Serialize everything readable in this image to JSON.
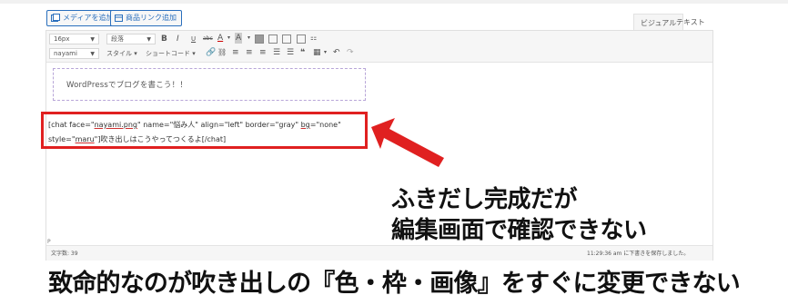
{
  "media_buttons": {
    "add_media": "メディアを追加",
    "product_link": "商品リンク追加"
  },
  "mode_tabs": {
    "visual": "ビジュアル",
    "text": "テキスト"
  },
  "toolbar": {
    "font_size": "16px",
    "paragraph": "段落",
    "font_family": "nayami",
    "styles": "スタイル",
    "shortcode": "ショートコード",
    "bold": "B",
    "italic": "I",
    "underline": "U",
    "strike": "abc"
  },
  "content": {
    "dashed_text": "WordPressでブログを書こう！！",
    "code_line1_pre": "[chat face=\"",
    "code_line1_file": "nayami.png",
    "code_line1_mid": "\" name=\"悩み人\" align=\"left\" border=\"gray\" ",
    "code_line1_bg": "bg",
    "code_line1_post": "=\"none\"",
    "code_line2_pre": "style=\"",
    "code_line2_maru": "maru",
    "code_line2_post": "\"]吹き出しはこうやってつくるよ[/chat]"
  },
  "callout": {
    "line1": "ふきだし完成だが",
    "line2": "編集画面で確認できない"
  },
  "status": {
    "path": "P",
    "word_count": "文字数: 39",
    "autosave": "11:29:36 am に下書きを保存しました。"
  },
  "caption": "致命的なのが吹き出しの『色・枠・画像』をすぐに変更できない",
  "colors": {
    "highlight_red": "#e02020",
    "link_blue": "#2a6fbd",
    "dashed_purple": "#b8a6d8"
  }
}
